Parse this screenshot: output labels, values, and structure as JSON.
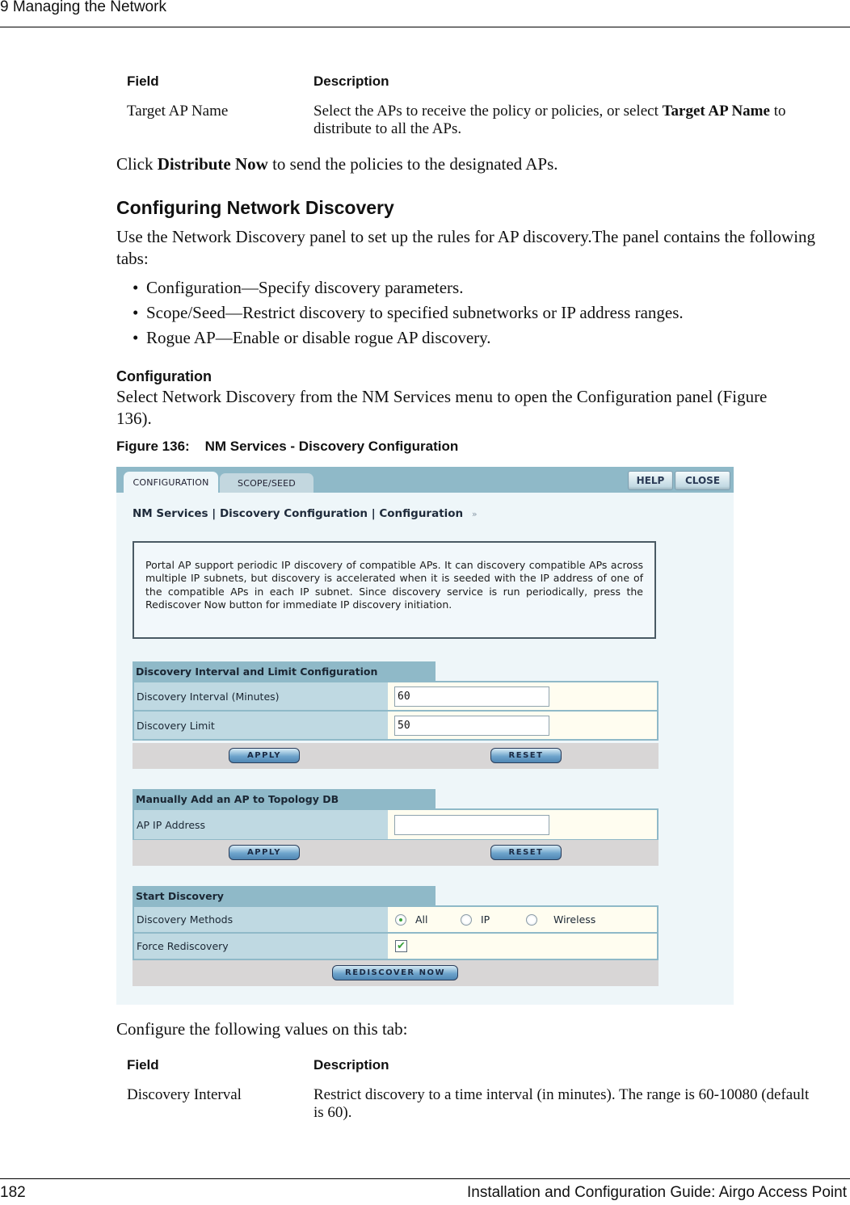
{
  "header": {
    "chapter_title": "9  Managing the Network"
  },
  "table1": {
    "col_field": "Field",
    "col_description": "Description",
    "rows": [
      {
        "field": "Target AP Name",
        "desc_pre": "Select the APs to receive the policy or policies, or select ",
        "desc_bold": "Target AP Name",
        "desc_post": " to distribute to all the APs."
      }
    ]
  },
  "para_distribute": {
    "pre": "Click ",
    "bold": "Distribute Now",
    "post": " to send the policies to the designated APs."
  },
  "section": {
    "heading": "Configuring Network Discovery",
    "intro": "Use the Network Discovery panel to set up the rules for AP discovery.The panel contains the following tabs:",
    "bullets": [
      "Configuration—Specify discovery parameters.",
      "Scope/Seed—Restrict discovery to specified subnetworks or IP address ranges.",
      "Rogue AP—Enable or disable rogue AP discovery."
    ]
  },
  "subsection": {
    "heading": "Configuration",
    "text": "Select Network Discovery from the NM Services menu to open the Configuration panel (Figure 136)."
  },
  "figure": {
    "caption": "Figure 136:    NM Services - Discovery Configuration",
    "tabs": [
      {
        "label": "CONFIGURATION",
        "active": true
      },
      {
        "label": "SCOPE/SEED",
        "active": false
      }
    ],
    "help_label": "HELP",
    "close_label": "CLOSE",
    "breadcrumb": [
      "NM Services",
      "Discovery Configuration",
      "Configuration"
    ],
    "breadcrumb_sep": "|",
    "breadcrumb_arrow": "»",
    "info_text": "Portal AP support periodic IP discovery of compatible APs. It can discovery compatible APs across multiple IP subnets, but discovery is accelerated when it is seeded with the IP address of one of the compatible APs in each IP subnet. Since discovery service is run periodically, press the Rediscover Now button for immediate IP discovery initiation.",
    "interval_section": {
      "title": "Discovery Interval and Limit Configuration",
      "interval_label": "Discovery Interval (Minutes)",
      "interval_value": "60",
      "limit_label": "Discovery Limit",
      "limit_value": "50",
      "apply_label": "APPLY",
      "reset_label": "RESET"
    },
    "manual_section": {
      "title": "Manually Add an AP to Topology DB",
      "ip_label": "AP IP Address",
      "ip_value": "",
      "apply_label": "APPLY",
      "reset_label": "RESET"
    },
    "start_section": {
      "title": "Start Discovery",
      "methods_label": "Discovery Methods",
      "methods": [
        {
          "label": "All",
          "selected": true
        },
        {
          "label": "IP",
          "selected": false
        },
        {
          "label": "Wireless",
          "selected": false
        }
      ],
      "force_label": "Force Rediscovery",
      "force_checked": true,
      "check_glyph": "✔",
      "rediscover_label": "REDISCOVER NOW"
    },
    "colors": {
      "topbar": "#8fb9c8",
      "panel_bg": "#eef6f9",
      "label_cell": "#bfd9e2",
      "value_cell": "#fffdf0",
      "button_row": "#d8d6d6",
      "radio_dot": "#3aa23a"
    }
  },
  "after_figure": {
    "text": "Configure the following values on this tab:"
  },
  "table2": {
    "col_field": "Field",
    "col_description": "Description",
    "rows": [
      {
        "field": "Discovery Interval",
        "description": "Restrict discovery to a time interval (in minutes). The range is 60-10080 (default is 60)."
      }
    ]
  },
  "footer": {
    "page_number": "182",
    "guide_title": "Installation and Configuration Guide: Airgo Access Point"
  }
}
